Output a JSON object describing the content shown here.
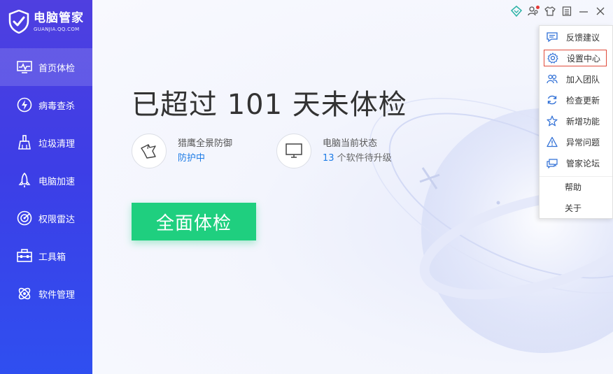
{
  "logo": {
    "title": "电脑管家",
    "subtitle": "GUANJIA.QQ.COM"
  },
  "sidebar": {
    "items": [
      {
        "label": "首页体检",
        "icon": "monitor-pulse-icon",
        "active": true
      },
      {
        "label": "病毒查杀",
        "icon": "lightning-icon"
      },
      {
        "label": "垃圾清理",
        "icon": "broom-icon"
      },
      {
        "label": "电脑加速",
        "icon": "rocket-icon"
      },
      {
        "label": "权限雷达",
        "icon": "radar-icon"
      },
      {
        "label": "工具箱",
        "icon": "toolbox-icon"
      },
      {
        "label": "软件管理",
        "icon": "software-icon"
      }
    ]
  },
  "main": {
    "headline": "已超过 101 天未体检",
    "protection": {
      "title": "猎鹰全景防御",
      "value": "防护中",
      "icon": "falcon-icon"
    },
    "pc_status": {
      "title": "电脑当前状态",
      "count": "13",
      "value_rest": " 个软件待升级",
      "icon": "monitor-icon"
    },
    "scan_button": "全面体检"
  },
  "titlebar": {
    "icons": [
      "diamond-icon",
      "friends-icon",
      "skin-icon",
      "menu-icon",
      "minimize-icon",
      "close-icon"
    ]
  },
  "menu": {
    "items": [
      {
        "label": "反馈建议",
        "icon": "feedback-icon"
      },
      {
        "label": "设置中心",
        "icon": "gear-icon",
        "highlight": true
      },
      {
        "label": "加入团队",
        "icon": "team-icon"
      },
      {
        "label": "检查更新",
        "icon": "refresh-icon"
      },
      {
        "label": "新增功能",
        "icon": "star-icon"
      },
      {
        "label": "异常问题",
        "icon": "warning-icon"
      },
      {
        "label": "管家论坛",
        "icon": "forum-icon"
      },
      {
        "label": "帮助"
      },
      {
        "label": "关于"
      }
    ]
  },
  "colors": {
    "sidebar_top": "#4f3fe0",
    "sidebar_bottom": "#2f4ff0",
    "scan_button": "#1fcf7f",
    "link_blue": "#1e7ce6",
    "highlight_border": "#e04a3a"
  }
}
